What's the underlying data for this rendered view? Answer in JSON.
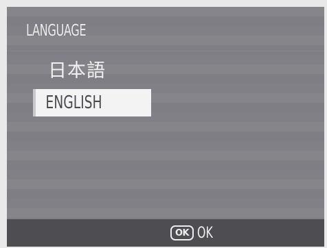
{
  "screen": {
    "title": "LANGUAGE"
  },
  "menu": {
    "items": [
      {
        "label": "日本語",
        "selected": false
      },
      {
        "label": "ENGLISH",
        "selected": true
      }
    ]
  },
  "footer": {
    "ok_icon_text": "OK",
    "ok_label": "OK"
  },
  "colors": {
    "background": "#7b7b80",
    "highlight": "#f3f3f3",
    "footer": "#4d4d52",
    "text": "#f1f1f1"
  }
}
